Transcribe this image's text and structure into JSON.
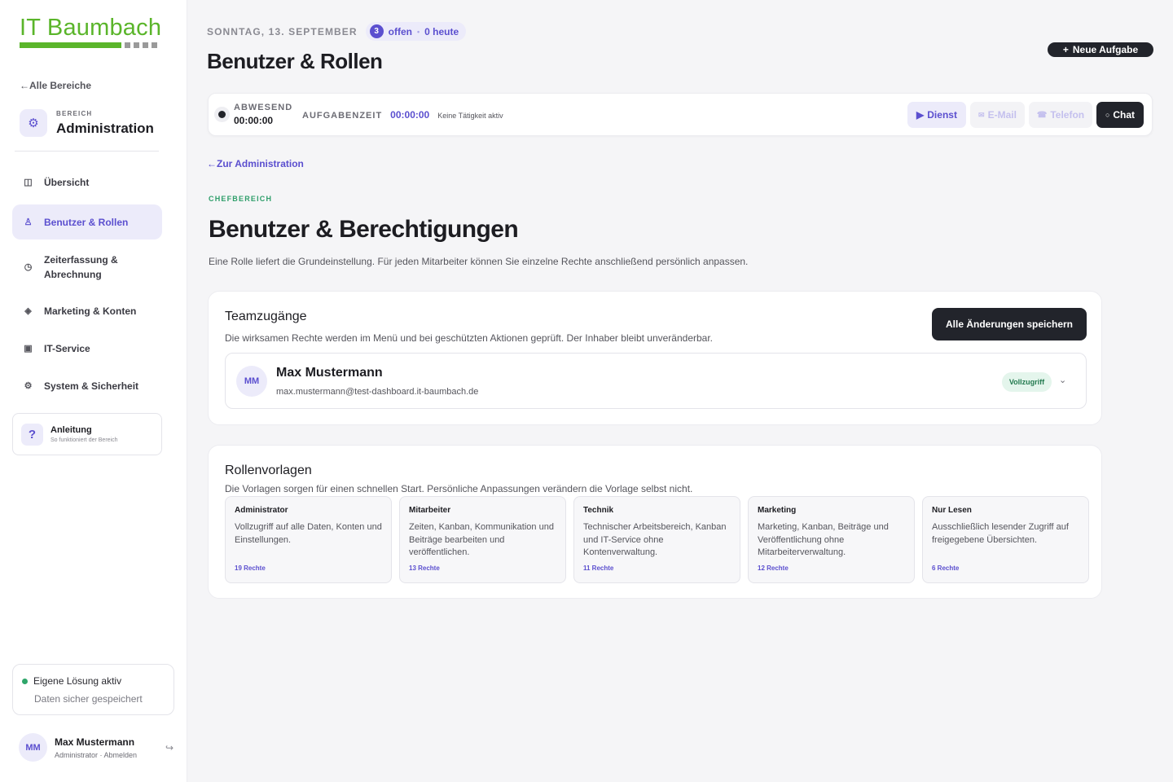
{
  "brand": {
    "name": "IT Baumbach",
    "green": "#5ab52a"
  },
  "sidebar": {
    "back_label": "Alle Bereiche",
    "area_kicker": "BEREICH",
    "area_name": "Administration",
    "area_icon": "gear-icon",
    "items": [
      {
        "label": "Übersicht",
        "icon": "layout-icon",
        "active": false
      },
      {
        "label": "Benutzer & Rollen",
        "icon": "user-icon",
        "active": true
      },
      {
        "label": "Zeiterfassung & Abrechnung",
        "icon": "clock-icon",
        "active": false
      },
      {
        "label": "Marketing & Konten",
        "icon": "diamond-icon",
        "active": false
      },
      {
        "label": "IT-Service",
        "icon": "server-icon",
        "active": false
      },
      {
        "label": "System & Sicherheit",
        "icon": "gear-icon",
        "active": false
      }
    ],
    "help": {
      "icon": "?",
      "title": "Anleitung",
      "subtitle": "So funktioniert der Bereich"
    },
    "status": {
      "title": "Eigene Lösung aktiv",
      "subtitle": "Daten sicher gespeichert",
      "color": "#2fa66a"
    },
    "user": {
      "initials": "MM",
      "name": "Max Mustermann",
      "role": "Administrator · Abmelden"
    }
  },
  "header": {
    "date": "SONNTAG, 13. SEPTEMBER",
    "open_count": "3",
    "open_label": "offen",
    "today_label": "0 heute",
    "title": "Benutzer & Rollen",
    "new_task_label": "Neue Aufgabe"
  },
  "timebar": {
    "status_label": "ABWESEND",
    "status_time": "00:00:00",
    "task_label": "AUFGABENZEIT",
    "task_time": "00:00:00",
    "task_hint": "Keine Tätigkeit aktiv",
    "buttons": {
      "dienst": "Dienst",
      "email": "E-Mail",
      "telefon": "Telefon",
      "chat": "Chat"
    }
  },
  "main": {
    "back_label": "Zur Administration",
    "kicker": "CHEFBEREICH",
    "title": "Benutzer & Berechtigungen",
    "description": "Eine Rolle liefert die Grundeinstellung. Für jeden Mitarbeiter können Sie einzelne Rechte anschließend persönlich anpassen."
  },
  "team": {
    "title": "Teamzugänge",
    "description": "Die wirksamen Rechte werden im Menü und bei geschützten Aktionen geprüft. Der Inhaber bleibt unveränderbar.",
    "save_label": "Alle Änderungen speichern",
    "members": [
      {
        "initials": "MM",
        "name": "Max Mustermann",
        "email": "max.mustermann@test-dashboard.it-baumbach.de",
        "badge": "Vollzugriff"
      }
    ]
  },
  "roles": {
    "title": "Rollenvorlagen",
    "description": "Die Vorlagen sorgen für einen schnellen Start. Persönliche Anpassungen verändern die Vorlage selbst nicht.",
    "items": [
      {
        "name": "Administrator",
        "desc": "Vollzugriff auf alle Daten, Konten und Einstellungen.",
        "count": "19 Rechte"
      },
      {
        "name": "Mitarbeiter",
        "desc": "Zeiten, Kanban, Kommunikation und Beiträge bearbeiten und veröffentlichen.",
        "count": "13 Rechte"
      },
      {
        "name": "Technik",
        "desc": "Technischer Arbeitsbereich, Kanban und IT-Service ohne Kontenverwaltung.",
        "count": "11 Rechte"
      },
      {
        "name": "Marketing",
        "desc": "Marketing, Kanban, Beiträge und Veröffentlichung ohne Mitarbeiterverwaltung.",
        "count": "12 Rechte"
      },
      {
        "name": "Nur Lesen",
        "desc": "Ausschließlich lesender Zugriff auf freigegebene Übersichten.",
        "count": "6 Rechte"
      }
    ]
  },
  "colors": {
    "accent": "#5b4fcf",
    "dark": "#22242b",
    "success": "#2e9e6a"
  }
}
